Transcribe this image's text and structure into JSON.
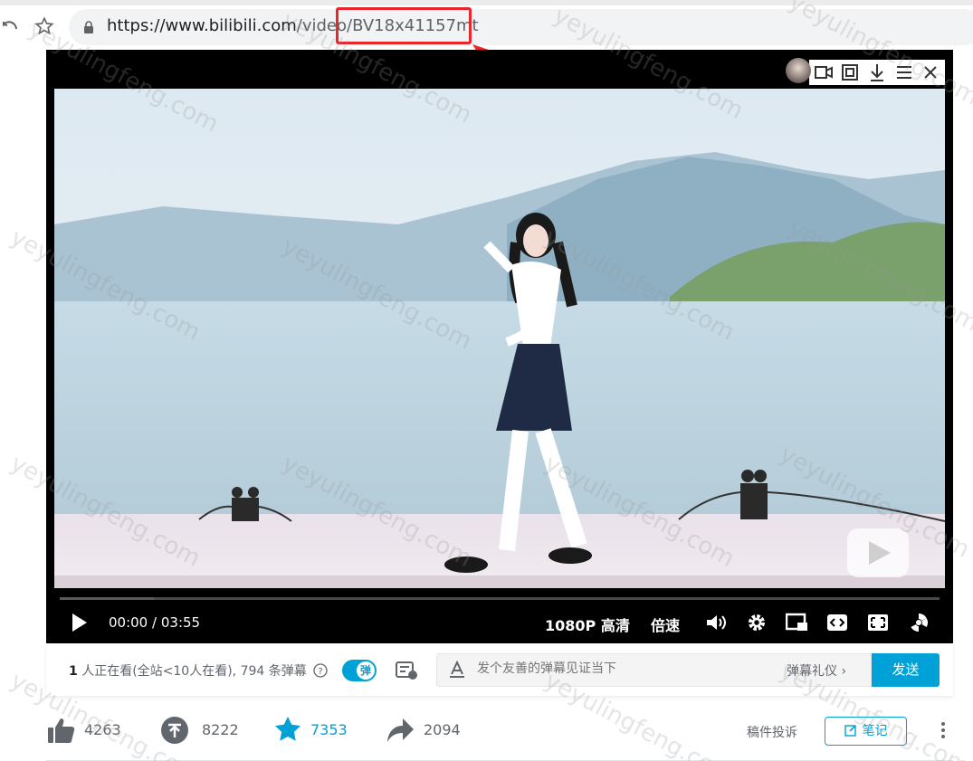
{
  "browser": {
    "url_host": "https://www.bilibili.com",
    "url_path": "/video/",
    "url_id": "BV18x41157mt"
  },
  "player": {
    "time_current": "00:00",
    "time_separator": "/",
    "time_total": "03:55",
    "quality": "1080P 高清",
    "speed": "倍速",
    "progress": 0.0
  },
  "danmaku": {
    "viewers_count": "1",
    "viewers_text": " 人正在看(全站<10人在看), 794 条弹幕",
    "toggle_label": "弹",
    "input_placeholder": "发个友善的弹幕见证当下",
    "etiquette_label": "弹幕礼仪 ›",
    "send_label": "发送"
  },
  "actions": {
    "like_count": "4263",
    "coin_count": "8222",
    "favorite_count": "7353",
    "share_count": "2094",
    "report_label": "稿件投诉",
    "note_label": "笔记"
  },
  "watermark": "yeyulingfeng.com",
  "colors": {
    "accent": "#00a1d6",
    "highlight": "#e8262b"
  }
}
